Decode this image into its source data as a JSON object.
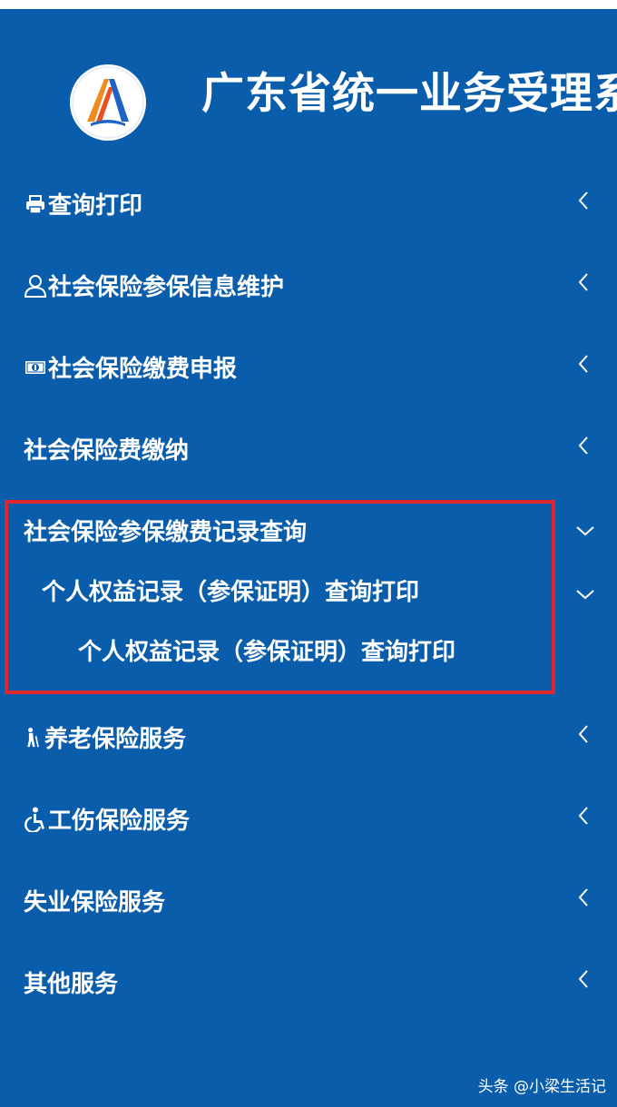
{
  "header": {
    "title": "广东省统一业务受理系"
  },
  "menu": {
    "items": [
      {
        "label": "查询打印",
        "icon": "printer-icon"
      },
      {
        "label": "社会保险参保信息维护",
        "icon": "user-icon"
      },
      {
        "label": "社会保险缴费申报",
        "icon": "money-icon"
      },
      {
        "label": "社会保险费缴纳"
      },
      {
        "label": "社会保险参保缴费记录查询"
      },
      {
        "label": "养老保险服务",
        "icon": "elderly-walking-icon"
      },
      {
        "label": "工伤保险服务",
        "icon": "wheelchair-icon"
      },
      {
        "label": "失业保险服务"
      },
      {
        "label": "其他服务"
      }
    ],
    "expanded": {
      "sub_item": "个人权益记录（参保证明）查询打印",
      "sub_sub_item": "个人权益记录（参保证明）查询打印"
    }
  },
  "watermark": "头条 @小梁生活记",
  "colors": {
    "panel_bg": "#0a5dab",
    "highlight": "#e0262e",
    "text": "#ffffff"
  }
}
